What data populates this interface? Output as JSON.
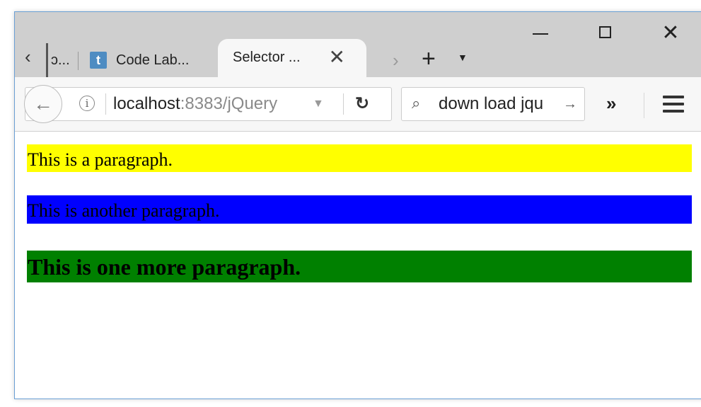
{
  "tabs": {
    "prev_tab_label": "ɔ...",
    "codelab_label": "Code Lab...",
    "codelab_favicon": "t",
    "active_label": "Selector ..."
  },
  "navbar": {
    "url_host": "localhost",
    "url_path": ":8383/jQuery",
    "search_text": "down load jqu"
  },
  "content": {
    "paragraphs": [
      {
        "text": "This is a paragraph.",
        "background": "#ffff00"
      },
      {
        "text": "This is another paragraph.",
        "background": "#0000ff"
      },
      {
        "text": "This is one more paragraph.",
        "background": "#008000"
      }
    ]
  },
  "colors": {
    "window_border": "#6a9fd4",
    "titlebar": "#cfcfcf",
    "favicon": "#4e8cc2"
  },
  "icons": [
    "chevron-left-icon",
    "close-icon",
    "chevron-right-icon",
    "plus-icon",
    "caret-down-icon",
    "minimize-icon",
    "maximize-icon",
    "back-arrow-icon",
    "info-icon",
    "reload-icon",
    "search-icon",
    "arrow-right-icon",
    "double-chevron-icon",
    "hamburger-menu-icon"
  ]
}
